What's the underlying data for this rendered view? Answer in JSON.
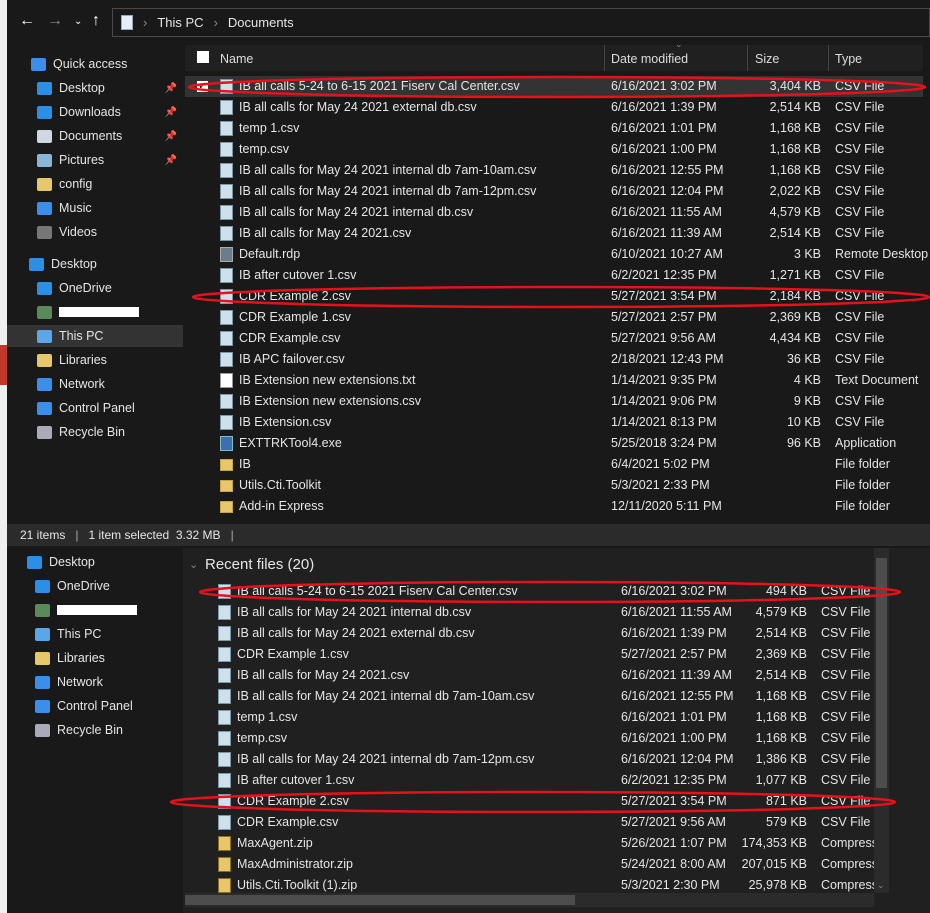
{
  "address": {
    "crumbs": [
      "This PC",
      "Documents"
    ]
  },
  "quick_access": [
    {
      "label": "Quick access",
      "icon": "star-icon",
      "color": "#3b8eea"
    },
    {
      "label": "Desktop",
      "icon": "desktop-icon",
      "color": "#2b8fe8",
      "pinned": true
    },
    {
      "label": "Downloads",
      "icon": "download-icon",
      "color": "#2b8fe8",
      "pinned": true
    },
    {
      "label": "Documents",
      "icon": "documents-icon",
      "color": "#cfd8e0",
      "pinned": true
    },
    {
      "label": "Pictures",
      "icon": "pictures-icon",
      "color": "#8ab4d8",
      "pinned": true
    },
    {
      "label": "config",
      "icon": "folder-icon",
      "color": "#e8c66a"
    },
    {
      "label": "Music",
      "icon": "music-icon",
      "color": "#3b8eea"
    },
    {
      "label": "Videos",
      "icon": "videos-icon",
      "color": "#777"
    }
  ],
  "nav_top": [
    {
      "label": "Desktop",
      "icon": "desktop-icon",
      "color": "#2b8fe8"
    },
    {
      "label": "OneDrive",
      "icon": "cloud-icon",
      "color": "#2b8fe8"
    },
    {
      "label": "",
      "icon": "user-icon",
      "color": "#5a8a5a"
    },
    {
      "label": "This PC",
      "icon": "computer-icon",
      "color": "#5aa7e8",
      "selected": true
    },
    {
      "label": "Libraries",
      "icon": "libraries-icon",
      "color": "#e8c66a"
    },
    {
      "label": "Network",
      "icon": "network-icon",
      "color": "#3b8eea"
    },
    {
      "label": "Control Panel",
      "icon": "control-panel-icon",
      "color": "#3b8eea"
    },
    {
      "label": "Recycle Bin",
      "icon": "recycle-bin-icon",
      "color": "#aab"
    }
  ],
  "columns": {
    "name": "Name",
    "date": "Date modified",
    "size": "Size",
    "type": "Type"
  },
  "files": [
    {
      "name": "IB all calls 5-24 to 6-15 2021 Fiserv Cal Center.csv",
      "date": "6/16/2021 3:02 PM",
      "size": "3,404 KB",
      "type": "CSV File",
      "kind": "csv",
      "selected": true
    },
    {
      "name": "IB all calls for May 24 2021 external db.csv",
      "date": "6/16/2021 1:39 PM",
      "size": "2,514 KB",
      "type": "CSV File",
      "kind": "csv"
    },
    {
      "name": "temp 1.csv",
      "date": "6/16/2021 1:01 PM",
      "size": "1,168 KB",
      "type": "CSV File",
      "kind": "csv"
    },
    {
      "name": "temp.csv",
      "date": "6/16/2021 1:00 PM",
      "size": "1,168 KB",
      "type": "CSV File",
      "kind": "csv"
    },
    {
      "name": "IB all calls for May 24 2021 internal db 7am-10am.csv",
      "date": "6/16/2021 12:55 PM",
      "size": "1,168 KB",
      "type": "CSV File",
      "kind": "csv"
    },
    {
      "name": "IB all calls for May 24 2021 internal db 7am-12pm.csv",
      "date": "6/16/2021 12:04 PM",
      "size": "2,022 KB",
      "type": "CSV File",
      "kind": "csv"
    },
    {
      "name": "IB all calls for May 24 2021 internal db.csv",
      "date": "6/16/2021 11:55 AM",
      "size": "4,579 KB",
      "type": "CSV File",
      "kind": "csv"
    },
    {
      "name": "IB all calls for May 24 2021.csv",
      "date": "6/16/2021 11:39 AM",
      "size": "2,514 KB",
      "type": "CSV File",
      "kind": "csv"
    },
    {
      "name": "Default.rdp",
      "date": "6/10/2021 10:27 AM",
      "size": "3 KB",
      "type": "Remote Desktop",
      "kind": "rdp"
    },
    {
      "name": "IB after cutover 1.csv",
      "date": "6/2/2021 12:35 PM",
      "size": "1,271 KB",
      "type": "CSV File",
      "kind": "csv"
    },
    {
      "name": "CDR Example 2.csv",
      "date": "5/27/2021 3:54 PM",
      "size": "2,184 KB",
      "type": "CSV File",
      "kind": "csv"
    },
    {
      "name": "CDR Example 1.csv",
      "date": "5/27/2021 2:57 PM",
      "size": "2,369 KB",
      "type": "CSV File",
      "kind": "csv"
    },
    {
      "name": "CDR Example.csv",
      "date": "5/27/2021 9:56 AM",
      "size": "4,434 KB",
      "type": "CSV File",
      "kind": "csv"
    },
    {
      "name": "IB APC failover.csv",
      "date": "2/18/2021 12:43 PM",
      "size": "36 KB",
      "type": "CSV File",
      "kind": "csv"
    },
    {
      "name": "IB Extension new extensions.txt",
      "date": "1/14/2021 9:35 PM",
      "size": "4 KB",
      "type": "Text Document",
      "kind": "txt"
    },
    {
      "name": "IB Extension new extensions.csv",
      "date": "1/14/2021 9:06 PM",
      "size": "9 KB",
      "type": "CSV File",
      "kind": "csv"
    },
    {
      "name": "IB Extension.csv",
      "date": "1/14/2021 8:13 PM",
      "size": "10 KB",
      "type": "CSV File",
      "kind": "csv"
    },
    {
      "name": "EXTTRKTool4.exe",
      "date": "5/25/2018 3:24 PM",
      "size": "96 KB",
      "type": "Application",
      "kind": "exe"
    },
    {
      "name": "IB",
      "date": "6/4/2021 5:02 PM",
      "size": "",
      "type": "File folder",
      "kind": "folder"
    },
    {
      "name": "Utils.Cti.Toolkit",
      "date": "5/3/2021 2:33 PM",
      "size": "",
      "type": "File folder",
      "kind": "folder"
    },
    {
      "name": "Add-in Express",
      "date": "12/11/2020 5:11 PM",
      "size": "",
      "type": "File folder",
      "kind": "folder"
    }
  ],
  "status": {
    "items": "21 items",
    "selected": "1 item selected  3.32 MB"
  },
  "nav_bottom": [
    {
      "label": "Desktop",
      "icon": "desktop-icon",
      "color": "#2b8fe8"
    },
    {
      "label": "OneDrive",
      "icon": "cloud-icon",
      "color": "#2b8fe8"
    },
    {
      "label": "",
      "icon": "user-icon",
      "color": "#5a8a5a"
    },
    {
      "label": "This PC",
      "icon": "computer-icon",
      "color": "#5aa7e8"
    },
    {
      "label": "Libraries",
      "icon": "libraries-icon",
      "color": "#e8c66a"
    },
    {
      "label": "Network",
      "icon": "network-icon",
      "color": "#3b8eea"
    },
    {
      "label": "Control Panel",
      "icon": "control-panel-icon",
      "color": "#3b8eea"
    },
    {
      "label": "Recycle Bin",
      "icon": "recycle-bin-icon",
      "color": "#aab"
    }
  ],
  "recent": {
    "title": "Recent files (20)",
    "files": [
      {
        "name": "IB all calls 5-24 to 6-15 2021 Fiserv Cal Center.csv",
        "date": "6/16/2021 3:02 PM",
        "size": "494 KB",
        "type": "CSV File",
        "kind": "csv"
      },
      {
        "name": "IB all calls for May 24 2021 internal db.csv",
        "date": "6/16/2021 11:55 AM",
        "size": "4,579 KB",
        "type": "CSV File",
        "kind": "csv"
      },
      {
        "name": "IB all calls for May 24 2021 external db.csv",
        "date": "6/16/2021 1:39 PM",
        "size": "2,514 KB",
        "type": "CSV File",
        "kind": "csv"
      },
      {
        "name": "CDR Example 1.csv",
        "date": "5/27/2021 2:57 PM",
        "size": "2,369 KB",
        "type": "CSV File",
        "kind": "csv"
      },
      {
        "name": "IB all calls for May 24 2021.csv",
        "date": "6/16/2021 11:39 AM",
        "size": "2,514 KB",
        "type": "CSV File",
        "kind": "csv"
      },
      {
        "name": "IB all calls for May 24 2021 internal db 7am-10am.csv",
        "date": "6/16/2021 12:55 PM",
        "size": "1,168 KB",
        "type": "CSV File",
        "kind": "csv"
      },
      {
        "name": "temp 1.csv",
        "date": "6/16/2021 1:01 PM",
        "size": "1,168 KB",
        "type": "CSV File",
        "kind": "csv"
      },
      {
        "name": "temp.csv",
        "date": "6/16/2021 1:00 PM",
        "size": "1,168 KB",
        "type": "CSV File",
        "kind": "csv"
      },
      {
        "name": "IB all calls for May 24 2021 internal db 7am-12pm.csv",
        "date": "6/16/2021 12:04 PM",
        "size": "1,386 KB",
        "type": "CSV File",
        "kind": "csv"
      },
      {
        "name": "IB after cutover 1.csv",
        "date": "6/2/2021 12:35 PM",
        "size": "1,077 KB",
        "type": "CSV File",
        "kind": "csv"
      },
      {
        "name": "CDR Example 2.csv",
        "date": "5/27/2021 3:54 PM",
        "size": "871 KB",
        "type": "CSV File",
        "kind": "csv"
      },
      {
        "name": "CDR Example.csv",
        "date": "5/27/2021 9:56 AM",
        "size": "579 KB",
        "type": "CSV File",
        "kind": "csv"
      },
      {
        "name": "MaxAgent.zip",
        "date": "5/26/2021 1:07 PM",
        "size": "174,353 KB",
        "type": "Compress",
        "kind": "zip"
      },
      {
        "name": "MaxAdministrator.zip",
        "date": "5/24/2021 8:00 AM",
        "size": "207,015 KB",
        "type": "Compress",
        "kind": "zip"
      },
      {
        "name": "Utils.Cti.Toolkit (1).zip",
        "date": "5/3/2021 2:30 PM",
        "size": "25,978 KB",
        "type": "Compress",
        "kind": "zip"
      }
    ]
  },
  "annotation_color": "#e8101a"
}
